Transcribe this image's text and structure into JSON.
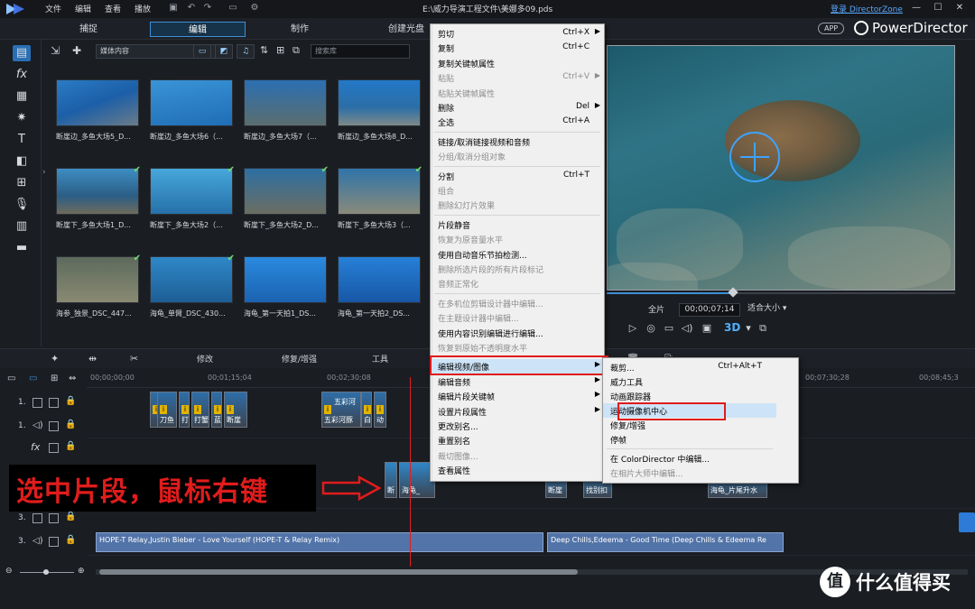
{
  "menubar": {
    "items": [
      "文件",
      "编辑",
      "查看",
      "播放"
    ],
    "document_title": "E:\\威力导演工程文件\\美娜多09.pds",
    "login_link": "登录 DirectorZone"
  },
  "mode_tabs": [
    {
      "label": "捕捉",
      "active": false
    },
    {
      "label": "编辑",
      "active": true
    },
    {
      "label": "制作",
      "active": false
    },
    {
      "label": "创建光盘",
      "active": false
    }
  ],
  "brand": {
    "app_badge": "APP",
    "name": "PowerDirector"
  },
  "library": {
    "filter_select": "媒体内容",
    "search_placeholder": "搜索库",
    "items": [
      {
        "label": "断崖边_多鱼大场5_D...",
        "checked": false
      },
      {
        "label": "断崖边_多鱼大场6（...",
        "checked": false
      },
      {
        "label": "断崖边_多鱼大场7（...",
        "checked": false
      },
      {
        "label": "断崖边_多鱼大场8_D...",
        "checked": false
      },
      {
        "label": "断崖下_多鱼大场1_D...",
        "checked": true
      },
      {
        "label": "断崖下_多鱼大场2（...",
        "checked": true
      },
      {
        "label": "断崖下_多鱼大场2_D...",
        "checked": true
      },
      {
        "label": "断崖下_多鱼大场3（...",
        "checked": true
      },
      {
        "label": "海参_独景_DSC_447...",
        "checked": true
      },
      {
        "label": "海龟_单臂_DSC_430...",
        "checked": true
      },
      {
        "label": "海龟_第一天拍1_DS...",
        "checked": false
      },
      {
        "label": "海龟_第一天拍2_DS...",
        "checked": false
      }
    ]
  },
  "preview": {
    "quality": "全片",
    "timecode": "00;00;07;14",
    "fit": "适合大小",
    "badge_3d": "3D"
  },
  "timeline_toolbar": {
    "modify": "修改",
    "fix_enhance": "修复/增强",
    "tools": "工具"
  },
  "ruler": {
    "ticks": [
      "00;00;00;00",
      "00;01;15;04",
      "00;02;30;08",
      "00;07;30;28",
      "00;08;45;3"
    ]
  },
  "tracks": [
    {
      "name": "1.",
      "type": "video"
    },
    {
      "name": "1.",
      "type": "audio"
    },
    {
      "name": "fx",
      "type": "effect"
    },
    {
      "name": "3.",
      "type": "video"
    },
    {
      "name": "3.",
      "type": "audio"
    }
  ],
  "clips": {
    "track1": [
      "刀鱼",
      "打",
      "打蟹",
      "蓝",
      "断崖",
      "五彩河",
      "五彩河豚",
      "白",
      "动"
    ],
    "track2": [
      "断",
      "海龟_",
      "断崖",
      "找别扣",
      "海龟_片尾升水"
    ],
    "audio3": [
      "HOPE-T Relay,Justin Bieber - Love Yourself (HOPE-T & Relay Remix)",
      "Deep Chills,Edeema - Good Time (Deep Chills & Edeema Re"
    ]
  },
  "annotation": {
    "text": "选中片段，鼠标右键"
  },
  "context_menu": {
    "items": [
      {
        "label": "剪切",
        "shortcut": "Ctrl+X",
        "arrow": true,
        "disabled": false
      },
      {
        "label": "复制",
        "shortcut": "Ctrl+C",
        "arrow": false,
        "disabled": false
      },
      {
        "label": "复制关键帧属性",
        "shortcut": "",
        "arrow": false,
        "disabled": false
      },
      {
        "label": "粘贴",
        "shortcut": "Ctrl+V",
        "arrow": true,
        "disabled": true
      },
      {
        "label": "粘贴关键帧属性",
        "shortcut": "",
        "arrow": false,
        "disabled": true
      },
      {
        "label": "删除",
        "shortcut": "Del",
        "arrow": true,
        "disabled": false
      },
      {
        "label": "全选",
        "shortcut": "Ctrl+A",
        "arrow": false,
        "disabled": false
      },
      {
        "sep": true
      },
      {
        "label": "链接/取消链接视频和音频",
        "shortcut": "",
        "arrow": false,
        "disabled": false
      },
      {
        "label": "分组/取消分组对象",
        "shortcut": "",
        "arrow": false,
        "disabled": true
      },
      {
        "sep": true
      },
      {
        "label": "分割",
        "shortcut": "Ctrl+T",
        "arrow": false,
        "disabled": false
      },
      {
        "label": "组合",
        "shortcut": "",
        "arrow": false,
        "disabled": true
      },
      {
        "label": "删除幻灯片效果",
        "shortcut": "",
        "arrow": false,
        "disabled": true
      },
      {
        "sep": true
      },
      {
        "label": "片段静音",
        "shortcut": "",
        "arrow": false,
        "disabled": false
      },
      {
        "label": "恢复为原音量水平",
        "shortcut": "",
        "arrow": false,
        "disabled": true
      },
      {
        "label": "使用自动音乐节拍检测...",
        "shortcut": "",
        "arrow": false,
        "disabled": false
      },
      {
        "label": "删除所选片段的所有片段标记",
        "shortcut": "",
        "arrow": false,
        "disabled": true
      },
      {
        "label": "音频正常化",
        "shortcut": "",
        "arrow": false,
        "disabled": true
      },
      {
        "sep": true
      },
      {
        "label": "在多机位剪辑设计器中编辑...",
        "shortcut": "",
        "arrow": false,
        "disabled": true
      },
      {
        "label": "在主题设计器中编辑...",
        "shortcut": "",
        "arrow": false,
        "disabled": true
      },
      {
        "label": "使用内容识别编辑进行编辑...",
        "shortcut": "",
        "arrow": false,
        "disabled": false
      },
      {
        "label": "恢复到原始不透明度水平",
        "shortcut": "",
        "arrow": false,
        "disabled": true
      },
      {
        "sep": true
      },
      {
        "label": "编辑视频/图像",
        "shortcut": "",
        "arrow": true,
        "disabled": false,
        "highlight": true
      },
      {
        "label": "编辑音频",
        "shortcut": "",
        "arrow": true,
        "disabled": false
      },
      {
        "label": "编辑片段关键帧",
        "shortcut": "",
        "arrow": true,
        "disabled": false
      },
      {
        "label": "设置片段属性",
        "shortcut": "",
        "arrow": true,
        "disabled": false
      },
      {
        "label": "更改别名...",
        "shortcut": "",
        "arrow": false,
        "disabled": false
      },
      {
        "label": "重置别名",
        "shortcut": "",
        "arrow": false,
        "disabled": false
      },
      {
        "label": "裁切图像...",
        "shortcut": "",
        "arrow": false,
        "disabled": true
      },
      {
        "label": "查看属性",
        "shortcut": "",
        "arrow": false,
        "disabled": false
      }
    ]
  },
  "submenu": {
    "items": [
      {
        "label": "裁剪...",
        "shortcut": "Ctrl+Alt+T",
        "disabled": false
      },
      {
        "label": "威力工具",
        "shortcut": "",
        "disabled": false
      },
      {
        "label": "动画跟踪器",
        "shortcut": "",
        "disabled": false
      },
      {
        "label": "运动摄像机中心",
        "shortcut": "",
        "disabled": false,
        "highlight": true
      },
      {
        "label": "修复/增强",
        "shortcut": "",
        "disabled": false
      },
      {
        "label": "停帧",
        "shortcut": "",
        "disabled": false
      },
      {
        "sep": true
      },
      {
        "label": "在 ColorDirector 中编辑...",
        "shortcut": "",
        "disabled": false
      },
      {
        "label": "在相片大师中编辑...",
        "shortcut": "",
        "disabled": true
      }
    ]
  },
  "watermark": {
    "icon": "值",
    "text": "什么值得买"
  },
  "colors": {
    "accent": "#3e8fd6",
    "annotation_red": "#e11c1c",
    "menu_bg": "#f0f0f0"
  }
}
